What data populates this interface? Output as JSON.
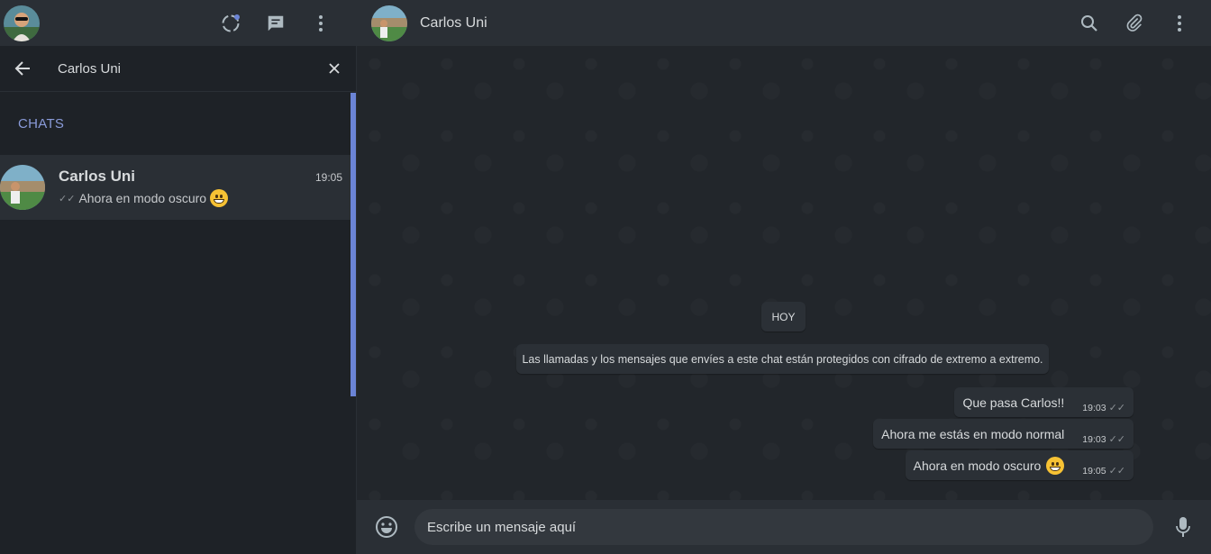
{
  "left": {
    "search": {
      "value": "Carlos Uni"
    },
    "section_title": "CHATS",
    "chats": [
      {
        "name": "Carlos Uni",
        "time": "19:05",
        "last_message": "Ahora en modo oscuro",
        "last_emoji": "grinning-face"
      }
    ]
  },
  "conversation": {
    "contact_name": "Carlos Uni",
    "day_label": "HOY",
    "encryption_notice": "Las llamadas y los mensajes que envíes a este chat están protegidos con cifrado de extremo a extremo.",
    "messages": [
      {
        "text": "Que pasa Carlos!!",
        "time": "19:03",
        "status": "delivered"
      },
      {
        "text": "Ahora me estás en modo normal",
        "time": "19:03",
        "status": "delivered"
      },
      {
        "text": "Ahora en modo oscuro",
        "time": "19:05",
        "status": "delivered",
        "emoji": "grinning-face"
      }
    ]
  },
  "composer": {
    "placeholder": "Escribe un mensaje aquí"
  },
  "colors": {
    "accent": "#8a9bd9",
    "scrollbar": "#6b84d6",
    "header_bg": "#2a2f35",
    "panel_bg": "#1e2227",
    "bubble_bg": "#2b3036"
  },
  "icons": [
    "status-icon",
    "new-chat-icon",
    "menu-icon",
    "back-arrow-icon",
    "close-icon",
    "search-icon",
    "attach-icon",
    "emoji-icon",
    "mic-icon"
  ]
}
